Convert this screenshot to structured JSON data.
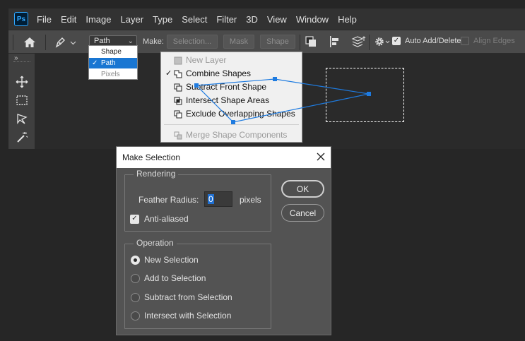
{
  "app": {
    "logo_text": "Ps"
  },
  "menubar": {
    "items": [
      "File",
      "Edit",
      "Image",
      "Layer",
      "Type",
      "Select",
      "Filter",
      "3D",
      "View",
      "Window",
      "Help"
    ]
  },
  "options_bar": {
    "mode_value": "Path",
    "make_label": "Make:",
    "selection_button": "Selection...",
    "mask_button": "Mask",
    "shape_button": "Shape",
    "auto_add_delete": {
      "label": "Auto Add/Delete",
      "checked": true
    },
    "align_edges": {
      "label": "Align Edges",
      "checked": false,
      "enabled": false
    }
  },
  "mode_dropdown": {
    "options": [
      {
        "label": "Shape",
        "selected": false,
        "enabled": true
      },
      {
        "label": "Path",
        "selected": true,
        "enabled": true
      },
      {
        "label": "Pixels",
        "selected": false,
        "enabled": false
      }
    ]
  },
  "path_operations_menu": {
    "items": [
      {
        "label": "New Layer",
        "enabled": false,
        "checked": false,
        "icon": "new-layer-icon"
      },
      {
        "label": "Combine Shapes",
        "enabled": true,
        "checked": true,
        "icon": "combine-shapes-icon"
      },
      {
        "label": "Subtract Front Shape",
        "enabled": true,
        "checked": false,
        "icon": "subtract-front-shape-icon"
      },
      {
        "label": "Intersect Shape Areas",
        "enabled": true,
        "checked": false,
        "icon": "intersect-shape-areas-icon"
      },
      {
        "label": "Exclude Overlapping Shapes",
        "enabled": true,
        "checked": false,
        "icon": "exclude-overlapping-shapes-icon"
      },
      {
        "label": "Merge Shape Components",
        "enabled": false,
        "checked": false,
        "icon": "merge-shape-components-icon"
      }
    ]
  },
  "dialog": {
    "title": "Make Selection",
    "rendering": {
      "legend": "Rendering",
      "feather_label": "Feather Radius:",
      "feather_value": "0",
      "feather_unit": "pixels",
      "anti_aliased": {
        "label": "Anti-aliased",
        "checked": true
      }
    },
    "operation": {
      "legend": "Operation",
      "options": [
        {
          "label": "New Selection",
          "selected": true
        },
        {
          "label": "Add to Selection",
          "selected": false
        },
        {
          "label": "Subtract from Selection",
          "selected": false
        },
        {
          "label": "Intersect with Selection",
          "selected": false
        }
      ]
    },
    "ok_label": "OK",
    "cancel_label": "Cancel"
  },
  "colors": {
    "accent_blue": "#1976d2",
    "path_anchor": "#1e7be0",
    "logo_blue": "#31a8ff"
  }
}
